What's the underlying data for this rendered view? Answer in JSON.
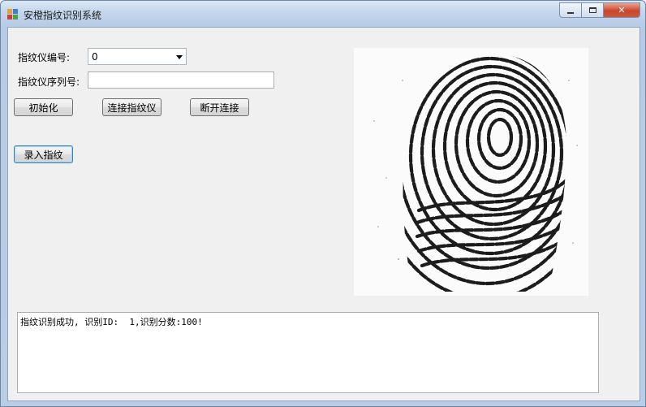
{
  "window": {
    "title": "安橙指纹识别系统",
    "close_glyph": "✕"
  },
  "form": {
    "device_number_label": "指纹仪编号:",
    "device_number_value": "0",
    "serial_label": "指纹仪序列号:",
    "serial_value": ""
  },
  "buttons": {
    "init": "初始化",
    "connect": "连接指纹仪",
    "disconnect": "断开连接",
    "enroll": "录入指纹"
  },
  "output": {
    "text": "指纹识别成功, 识别ID:  1,识别分数:100!"
  }
}
